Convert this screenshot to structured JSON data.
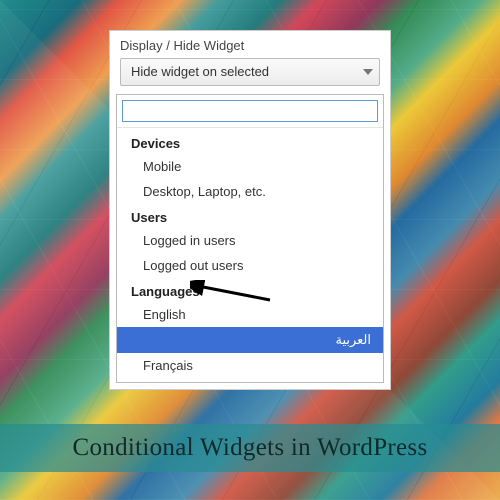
{
  "header": {
    "label": "Display / Hide Widget",
    "selected": "Hide widget on selected"
  },
  "groups": [
    {
      "title": "Devices",
      "items": [
        "Mobile",
        "Desktop, Laptop, etc."
      ]
    },
    {
      "title": "Users",
      "items": [
        "Logged in users",
        "Logged out users"
      ]
    },
    {
      "title": "Languages",
      "items": [
        "English",
        "العربية",
        "Français"
      ]
    }
  ],
  "selected_item": "العربية",
  "caption": "Conditional Widgets in WordPress"
}
